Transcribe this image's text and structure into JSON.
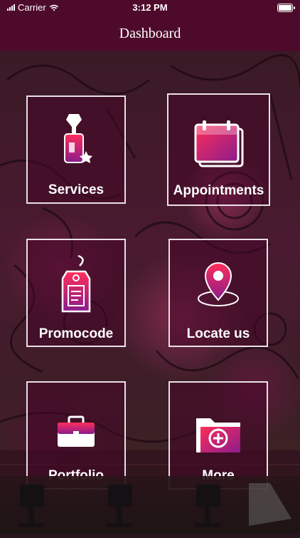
{
  "status_bar": {
    "carrier": "Carrier",
    "time": "3:12 PM"
  },
  "nav": {
    "title": "Dashboard"
  },
  "tiles": [
    {
      "label": "Services",
      "icon": "nail-polish-icon"
    },
    {
      "label": "Appointments",
      "icon": "calendar-icon"
    },
    {
      "label": "Promocode",
      "icon": "price-tag-icon"
    },
    {
      "label": "Locate us",
      "icon": "location-pin-icon"
    },
    {
      "label": "Portfolio",
      "icon": "briefcase-icon"
    },
    {
      "label": "More",
      "icon": "folder-add-icon"
    }
  ],
  "colors": {
    "brand": "#4e0a2a",
    "icon_gradient_start": "#ff2e5a",
    "icon_gradient_end": "#8a1c8c"
  }
}
